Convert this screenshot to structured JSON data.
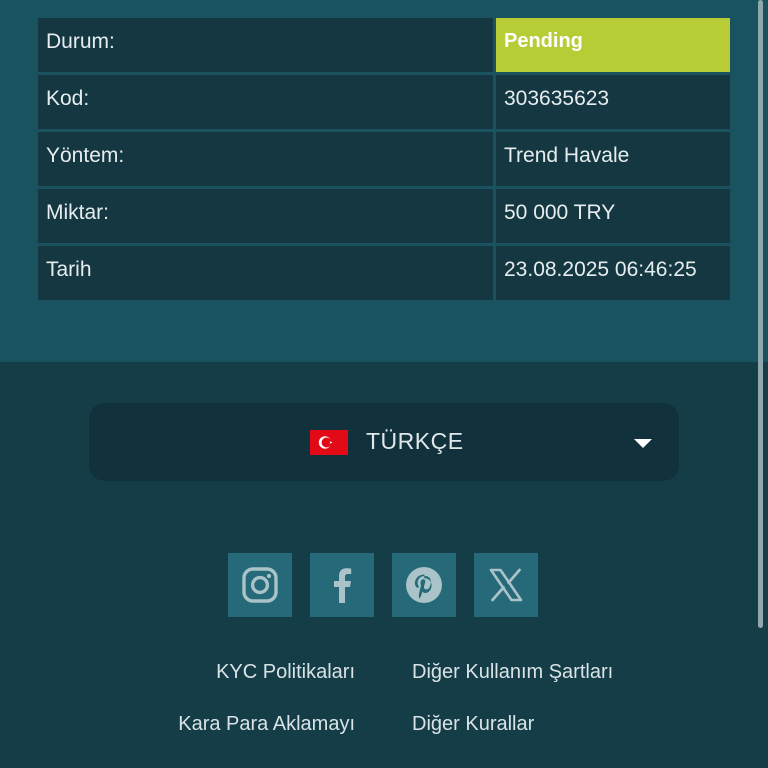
{
  "details": {
    "rows": [
      {
        "label": "Durum:",
        "value": "Pending"
      },
      {
        "label": "Kod:",
        "value": "303635623"
      },
      {
        "label": "Yöntem:",
        "value": "Trend Havale"
      },
      {
        "label": "Miktar:",
        "value": "50 000 TRY"
      },
      {
        "label": "Tarih",
        "value": "23.08.2025 06:46:25"
      }
    ]
  },
  "language": {
    "selected": "TÜRKÇE",
    "flag_icon": "turkey-flag-icon"
  },
  "socials": [
    "instagram-icon",
    "facebook-icon",
    "pinterest-icon",
    "x-icon"
  ],
  "footer": {
    "links_left": [
      "KYC Politikaları",
      "Kara Para Aklamayı"
    ],
    "links_right": [
      "Diğer Kullanım Şartları",
      "Diğer Kurallar"
    ]
  },
  "colors": {
    "status_pending": "#b8cc35",
    "top_bg": "#1a5360",
    "footer_bg": "#143d48",
    "cell_bg": "#143742",
    "social_bg": "#266978"
  }
}
